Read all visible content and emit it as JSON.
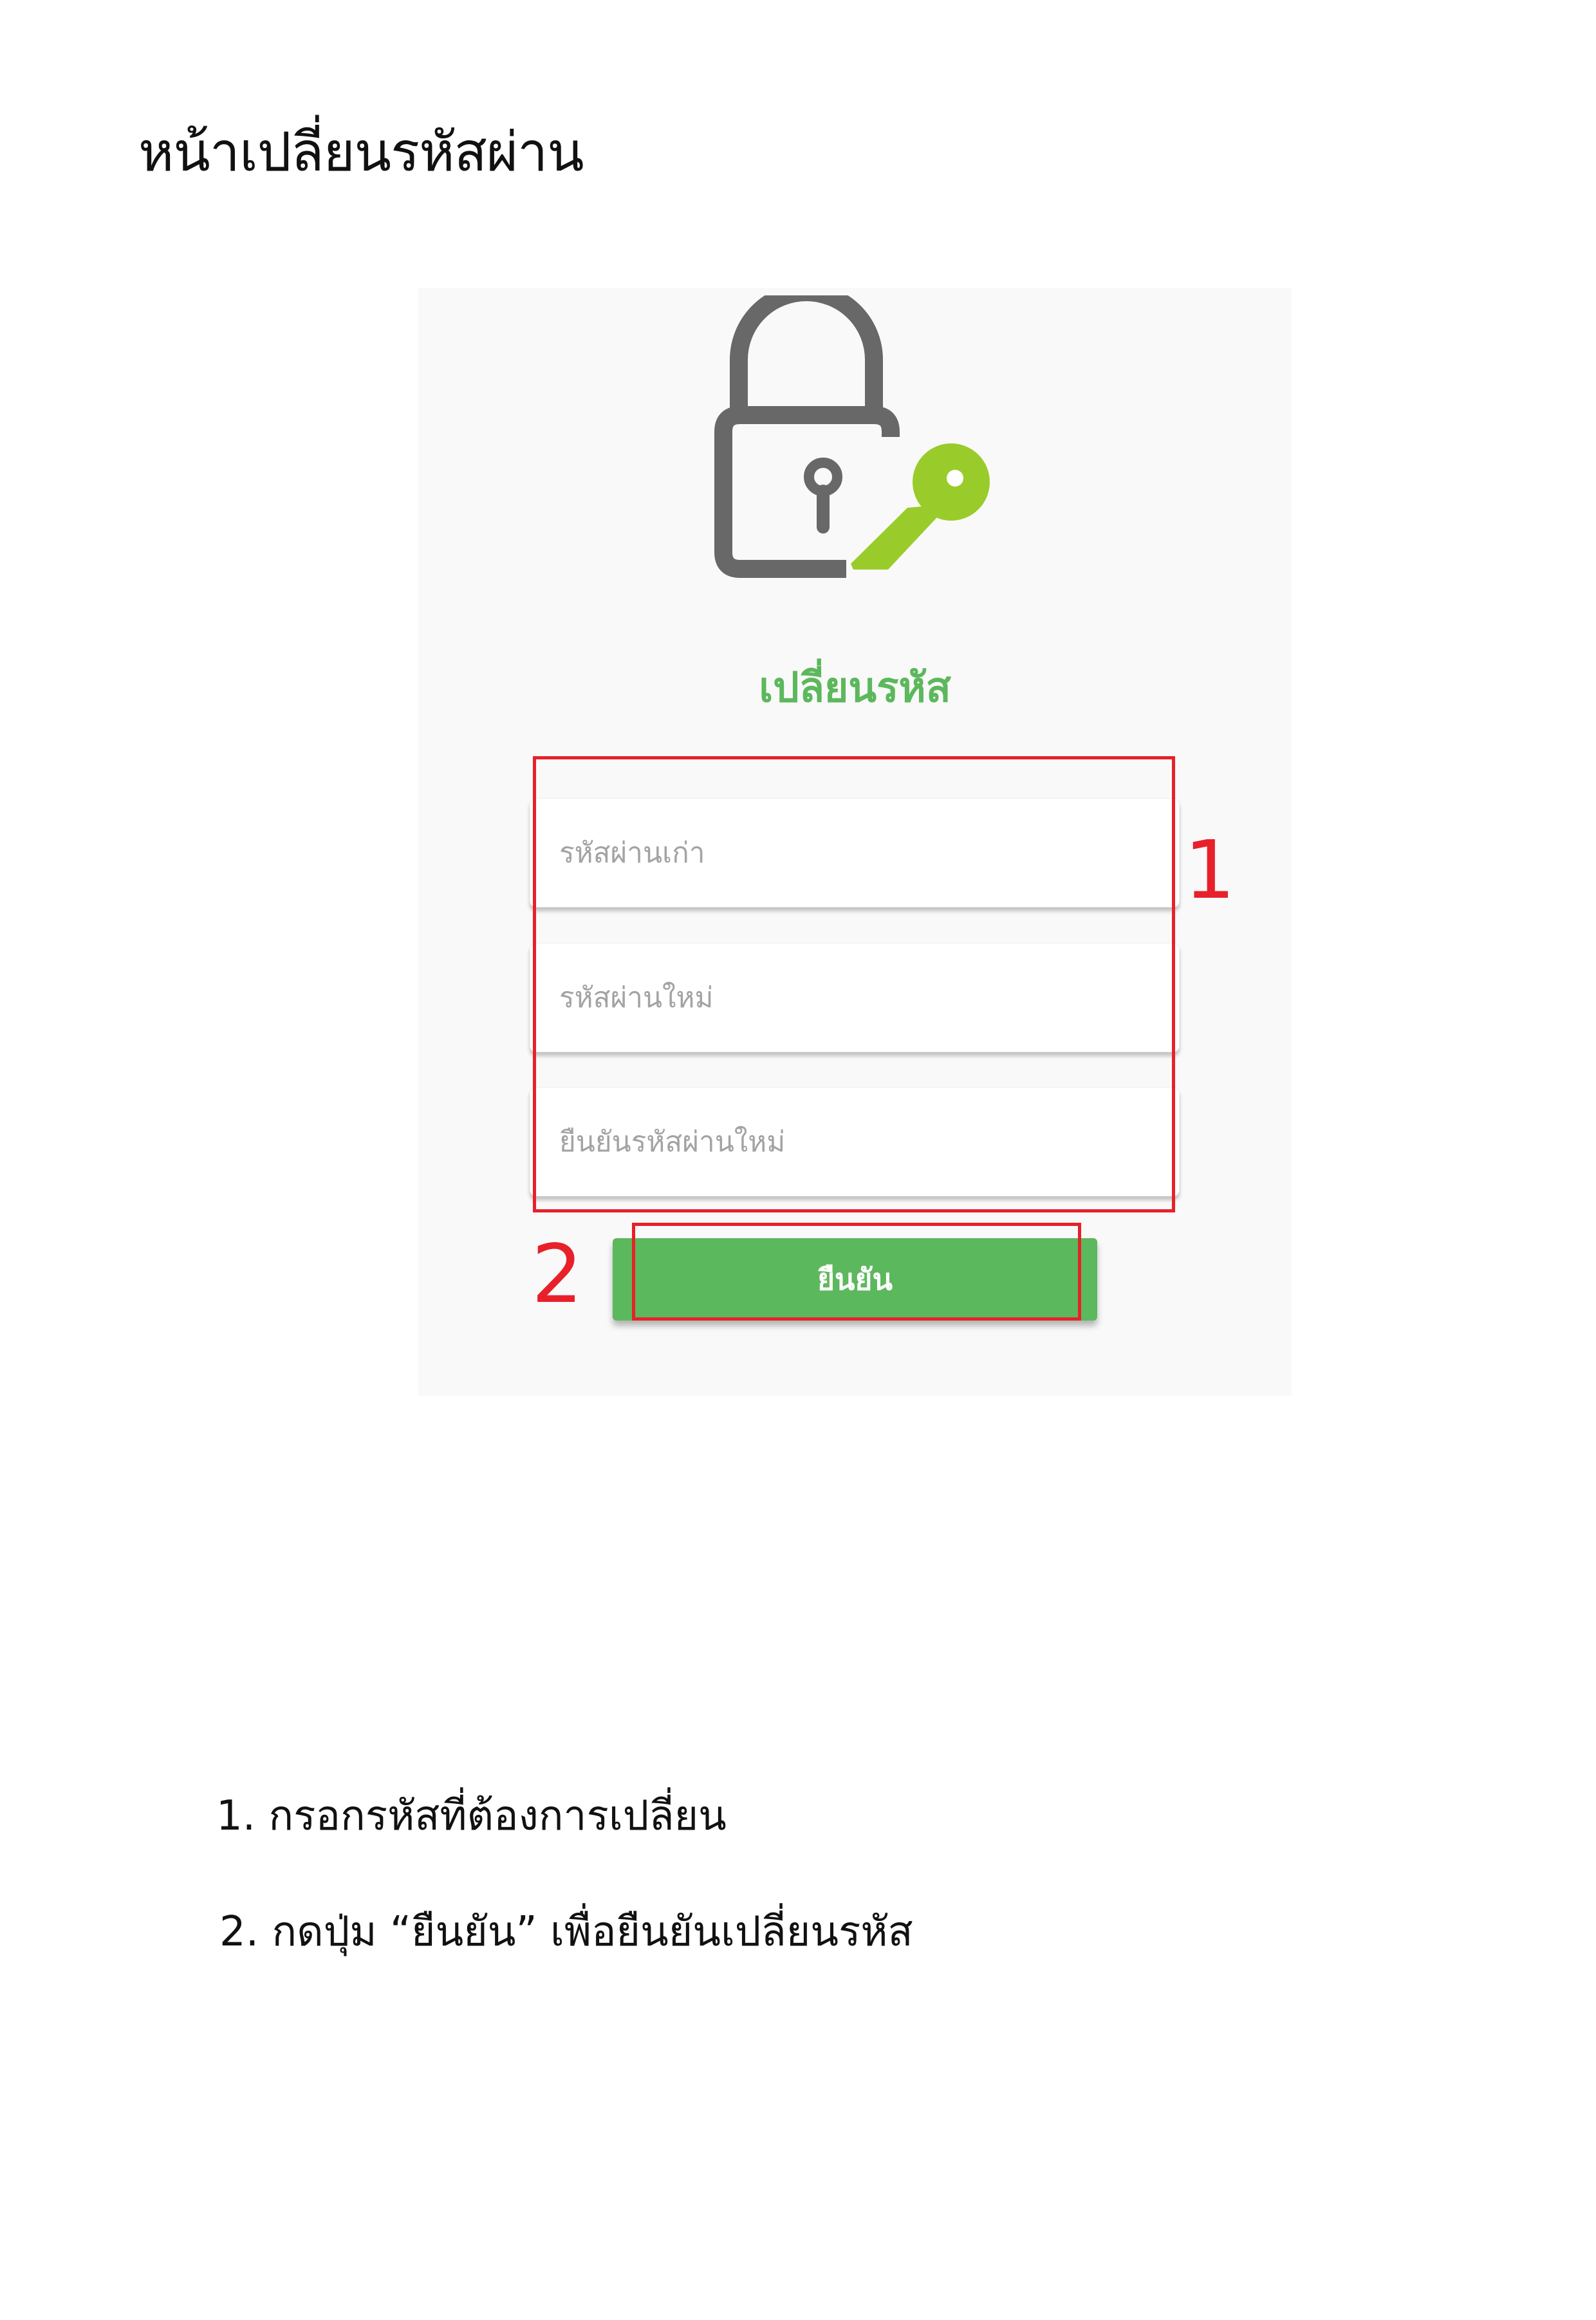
{
  "document": {
    "page_title": "หน้าเปลี่ยนรหัสผ่าน",
    "callout_1": "1",
    "callout_2": "2",
    "steps": [
      "1. กรอกรหัสที่ต้องการเปลี่ยน",
      "2. กดปุ่ม “ยืนยัน” เพื่อยืนยันเปลี่ยนรหัส"
    ]
  },
  "app": {
    "form_title": "เปลี่ยนรหัส",
    "fields": {
      "old_password_placeholder": "รหัสผ่านเก่า",
      "new_password_placeholder": "รหัสผ่านใหม่",
      "confirm_password_placeholder": "ยืนยันรหัสผ่านใหม่"
    },
    "confirm_button_label": "ยืนยัน"
  },
  "icons": {
    "hero": "lock-with-key-icon"
  },
  "colors": {
    "accent_green": "#5cb85c",
    "key_green": "#99cc2a",
    "lock_gray": "#686868",
    "annotation_red": "#e8202a",
    "panel_background": "#f9f9f9"
  }
}
